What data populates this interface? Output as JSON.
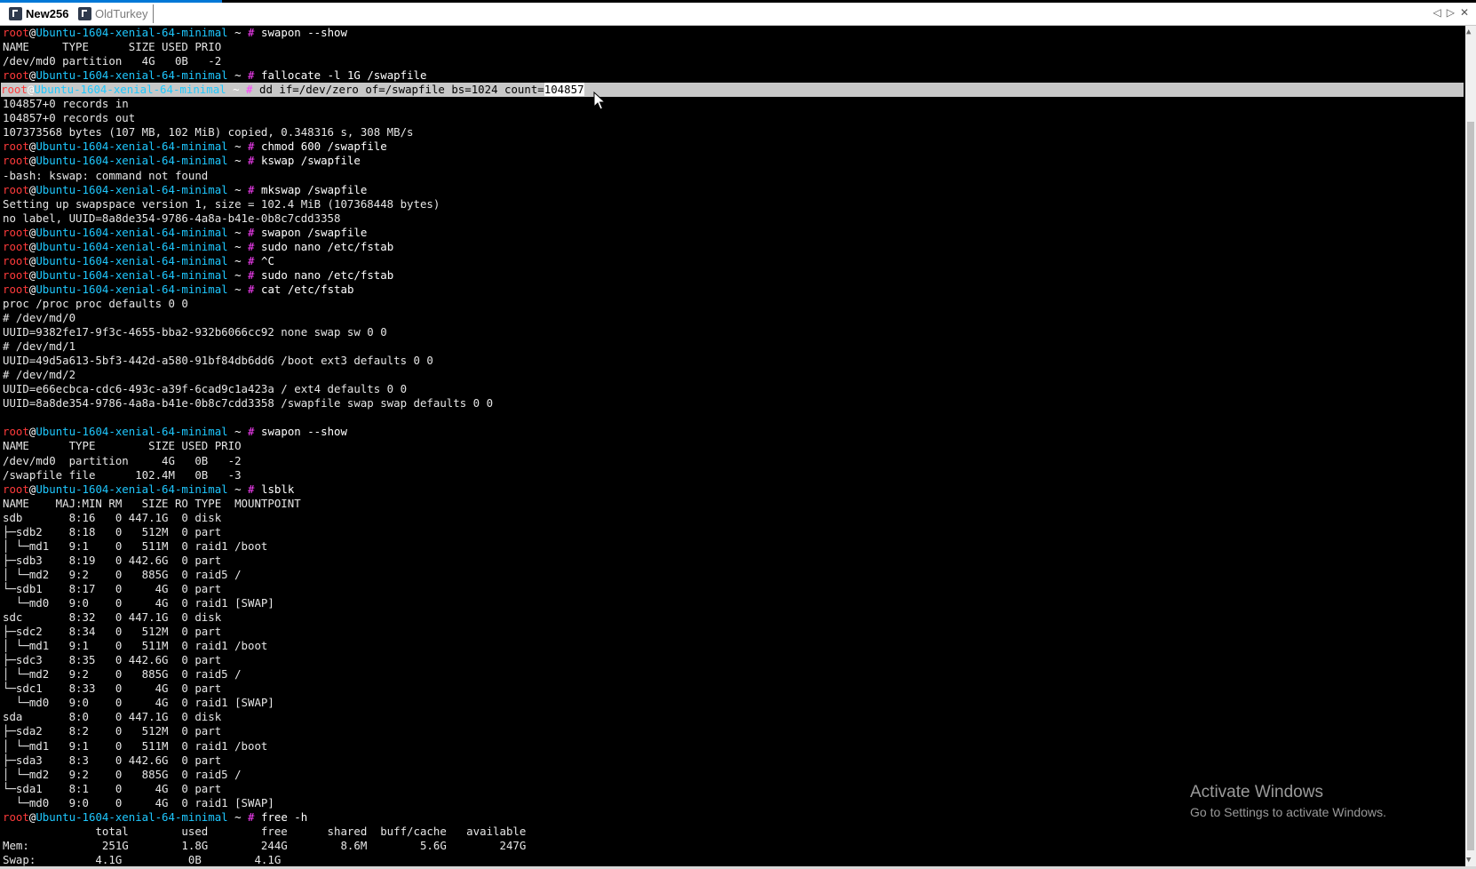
{
  "tabs": [
    {
      "label": "New256",
      "active": true
    },
    {
      "label": "OldTurkey",
      "active": false
    }
  ],
  "tab_controls": [
    "◁",
    "▷",
    "✕"
  ],
  "prompt": {
    "user": "root",
    "at": "@",
    "host": "Ubuntu-1604-xenial-64-minimal",
    "path": " ~ ",
    "symbol": "#"
  },
  "colors": {
    "user": "#ff3b3b",
    "host": "#1ec8ff",
    "hash": "#ff40ff",
    "background": "#000000",
    "selection": "#c8c8c8"
  },
  "terminal_lines": [
    {
      "type": "prompt",
      "cmd": "swapon --show"
    },
    {
      "type": "out",
      "text": "NAME     TYPE      SIZE USED PRIO"
    },
    {
      "type": "out",
      "text": "/dev/md0 partition   4G   0B   -2"
    },
    {
      "type": "prompt",
      "cmd": "fallocate -l 1G /swapfile"
    },
    {
      "type": "prompt",
      "cmd": "dd if=/dev/zero of=/swapfile bs=1024 count=",
      "sel": "104857",
      "highlight": true
    },
    {
      "type": "out",
      "text": "104857+0 records in"
    },
    {
      "type": "out",
      "text": "104857+0 records out"
    },
    {
      "type": "out",
      "text": "107373568 bytes (107 MB, 102 MiB) copied, 0.348316 s, 308 MB/s"
    },
    {
      "type": "prompt",
      "cmd": "chmod 600 /swapfile"
    },
    {
      "type": "prompt",
      "cmd": "kswap /swapfile"
    },
    {
      "type": "out",
      "text": "-bash: kswap: command not found"
    },
    {
      "type": "prompt",
      "cmd": "mkswap /swapfile"
    },
    {
      "type": "out",
      "text": "Setting up swapspace version 1, size = 102.4 MiB (107368448 bytes)"
    },
    {
      "type": "out",
      "text": "no label, UUID=8a8de354-9786-4a8a-b41e-0b8c7cdd3358"
    },
    {
      "type": "prompt",
      "cmd": "swapon /swapfile"
    },
    {
      "type": "prompt",
      "cmd": "sudo nano /etc/fstab"
    },
    {
      "type": "prompt",
      "cmd": "^C"
    },
    {
      "type": "prompt",
      "cmd": "sudo nano /etc/fstab"
    },
    {
      "type": "prompt",
      "cmd": "cat /etc/fstab"
    },
    {
      "type": "out",
      "text": "proc /proc proc defaults 0 0"
    },
    {
      "type": "out",
      "text": "# /dev/md/0"
    },
    {
      "type": "out",
      "text": "UUID=9382fe17-9f3c-4655-bba2-932b6066cc92 none swap sw 0 0"
    },
    {
      "type": "out",
      "text": "# /dev/md/1"
    },
    {
      "type": "out",
      "text": "UUID=49d5a613-5bf3-442d-a580-91bf84db6dd6 /boot ext3 defaults 0 0"
    },
    {
      "type": "out",
      "text": "# /dev/md/2"
    },
    {
      "type": "out",
      "text": "UUID=e66ecbca-cdc6-493c-a39f-6cad9c1a423a / ext4 defaults 0 0"
    },
    {
      "type": "out",
      "text": "UUID=8a8de354-9786-4a8a-b41e-0b8c7cdd3358 /swapfile swap swap defaults 0 0"
    },
    {
      "type": "out",
      "text": ""
    },
    {
      "type": "prompt",
      "cmd": "swapon --show"
    },
    {
      "type": "out",
      "text": "NAME      TYPE        SIZE USED PRIO"
    },
    {
      "type": "out",
      "text": "/dev/md0  partition     4G   0B   -2"
    },
    {
      "type": "out",
      "text": "/swapfile file      102.4M   0B   -3"
    },
    {
      "type": "prompt",
      "cmd": "lsblk"
    },
    {
      "type": "out",
      "text": "NAME    MAJ:MIN RM   SIZE RO TYPE  MOUNTPOINT"
    },
    {
      "type": "out",
      "text": "sdb       8:16   0 447.1G  0 disk"
    },
    {
      "type": "out",
      "text": "├─sdb2    8:18   0   512M  0 part"
    },
    {
      "type": "out",
      "text": "│ └─md1   9:1    0   511M  0 raid1 /boot"
    },
    {
      "type": "out",
      "text": "├─sdb3    8:19   0 442.6G  0 part"
    },
    {
      "type": "out",
      "text": "│ └─md2   9:2    0   885G  0 raid5 /"
    },
    {
      "type": "out",
      "text": "└─sdb1    8:17   0     4G  0 part"
    },
    {
      "type": "out",
      "text": "  └─md0   9:0    0     4G  0 raid1 [SWAP]"
    },
    {
      "type": "out",
      "text": "sdc       8:32   0 447.1G  0 disk"
    },
    {
      "type": "out",
      "text": "├─sdc2    8:34   0   512M  0 part"
    },
    {
      "type": "out",
      "text": "│ └─md1   9:1    0   511M  0 raid1 /boot"
    },
    {
      "type": "out",
      "text": "├─sdc3    8:35   0 442.6G  0 part"
    },
    {
      "type": "out",
      "text": "│ └─md2   9:2    0   885G  0 raid5 /"
    },
    {
      "type": "out",
      "text": "└─sdc1    8:33   0     4G  0 part"
    },
    {
      "type": "out",
      "text": "  └─md0   9:0    0     4G  0 raid1 [SWAP]"
    },
    {
      "type": "out",
      "text": "sda       8:0    0 447.1G  0 disk"
    },
    {
      "type": "out",
      "text": "├─sda2    8:2    0   512M  0 part"
    },
    {
      "type": "out",
      "text": "│ └─md1   9:1    0   511M  0 raid1 /boot"
    },
    {
      "type": "out",
      "text": "├─sda3    8:3    0 442.6G  0 part"
    },
    {
      "type": "out",
      "text": "│ └─md2   9:2    0   885G  0 raid5 /"
    },
    {
      "type": "out",
      "text": "└─sda1    8:1    0     4G  0 part"
    },
    {
      "type": "out",
      "text": "  └─md0   9:0    0     4G  0 raid1 [SWAP]"
    },
    {
      "type": "prompt",
      "cmd": "free -h"
    },
    {
      "type": "out",
      "text": "              total        used        free      shared  buff/cache   available"
    },
    {
      "type": "out",
      "text": "Mem:           251G        1.8G        244G        8.6M        5.6G        247G"
    },
    {
      "type": "out",
      "text": "Swap:         4.1G          0B        4.1G"
    }
  ],
  "watermark": {
    "title": "Activate Windows",
    "subtitle": "Go to Settings to activate Windows."
  },
  "scrollbar": {
    "up_arrow": "▲",
    "down_arrow": "▼"
  }
}
